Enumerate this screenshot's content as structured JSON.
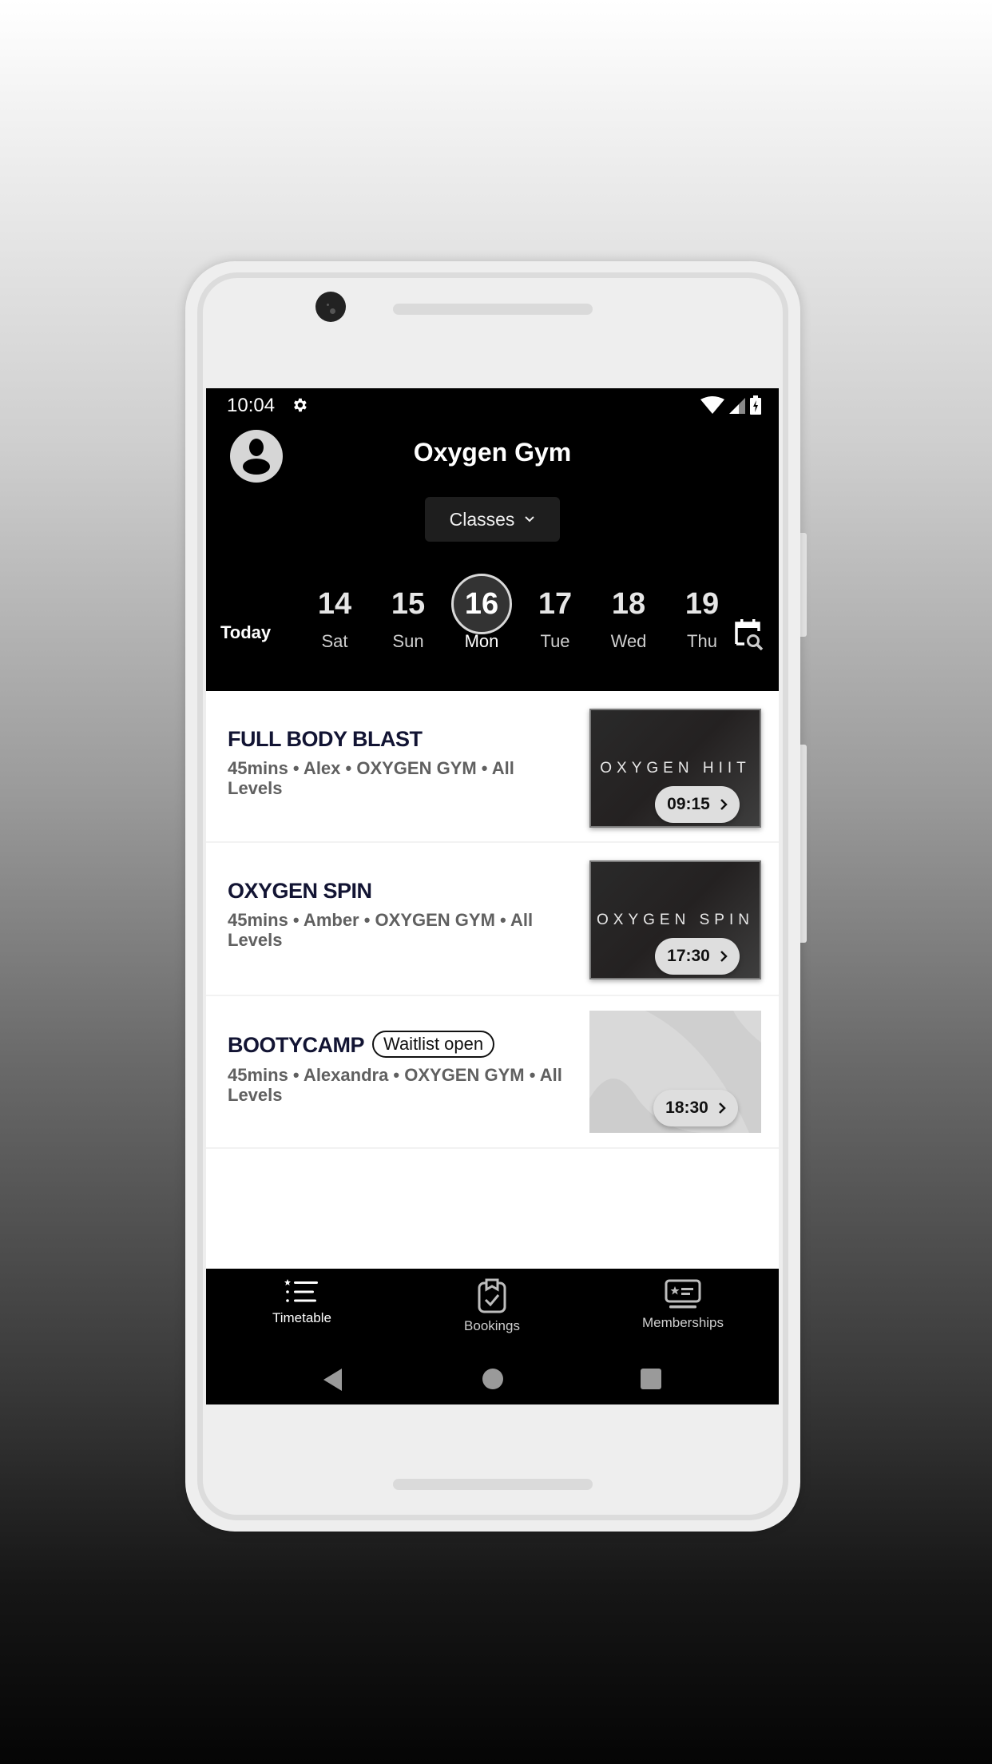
{
  "status_bar": {
    "time": "10:04",
    "icons": [
      "gear-icon",
      "wifi-icon",
      "signal-icon",
      "battery-charging-icon"
    ]
  },
  "header": {
    "title": "Oxygen Gym",
    "avatar_icon": "account-circle-icon",
    "dropdown": {
      "selected": "Classes",
      "icon": "chevron-down-icon"
    }
  },
  "date_strip": {
    "today_label": "Today",
    "days": [
      {
        "num": "14",
        "dow": "Sat",
        "selected": false
      },
      {
        "num": "15",
        "dow": "Sun",
        "selected": false
      },
      {
        "num": "16",
        "dow": "Mon",
        "selected": true
      },
      {
        "num": "17",
        "dow": "Tue",
        "selected": false
      },
      {
        "num": "18",
        "dow": "Wed",
        "selected": false
      },
      {
        "num": "19",
        "dow": "Thu",
        "selected": false
      }
    ],
    "calendar_search_icon": "calendar-search-icon"
  },
  "classes": [
    {
      "name": "FULL BODY BLAST",
      "meta": "45mins • Alex • OXYGEN GYM • All Levels",
      "image_label": "OXYGEN HIIT",
      "time": "09:15",
      "badge": null
    },
    {
      "name": "OXYGEN SPIN",
      "meta": "45mins • Amber • OXYGEN GYM • All Levels",
      "image_label": "OXYGEN SPIN",
      "time": "17:30",
      "badge": null
    },
    {
      "name": "BOOTYCAMP",
      "meta": "45mins • Alexandra • OXYGEN GYM • All Levels",
      "image_label": "",
      "time": "18:30",
      "badge": "Waitlist open"
    }
  ],
  "bottom_nav": {
    "items": [
      {
        "label": "Timetable",
        "icon": "timetable-list-icon",
        "active": true
      },
      {
        "label": "Bookings",
        "icon": "clipboard-check-icon",
        "active": false
      },
      {
        "label": "Memberships",
        "icon": "membership-card-icon",
        "active": false
      }
    ]
  },
  "system_nav": [
    "back-icon",
    "home-icon",
    "recents-icon"
  ],
  "colors": {
    "header_bg": "#000000",
    "class_title": "#121433",
    "meta_text": "#606060",
    "selected_day_bg": "#333333"
  }
}
